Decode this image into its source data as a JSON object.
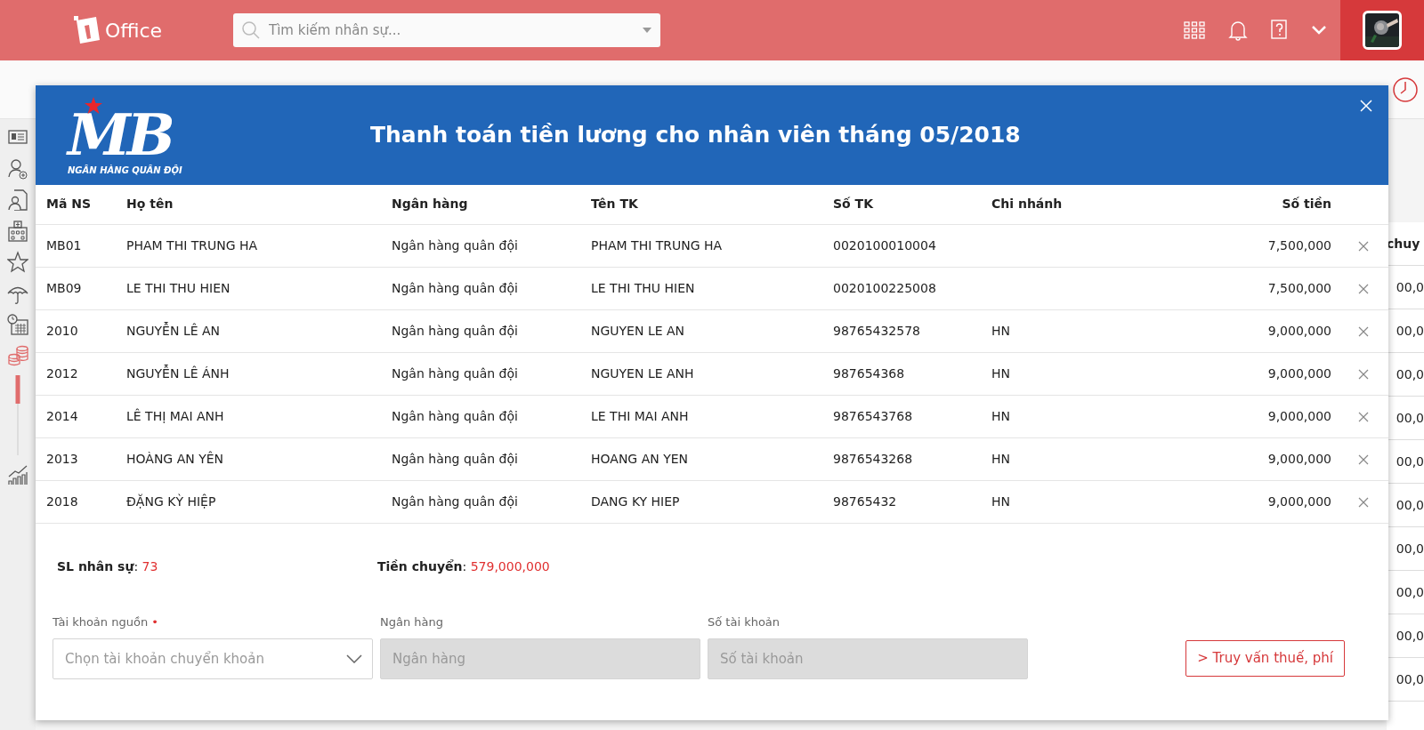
{
  "topbar": {
    "logo_text": "Office",
    "search": {
      "placeholder": "Tìm kiếm nhân sự..."
    }
  },
  "sidebar": {
    "items": [
      {
        "kind": "id-card",
        "selected": false
      },
      {
        "kind": "user-add",
        "selected": false
      },
      {
        "kind": "user-doc",
        "selected": false
      },
      {
        "kind": "building",
        "selected": false
      },
      {
        "kind": "star",
        "selected": false
      },
      {
        "kind": "umbrella",
        "selected": false
      },
      {
        "kind": "calendar",
        "selected": false
      },
      {
        "kind": "coins",
        "selected": true
      },
      {
        "kind": "chart",
        "selected": false
      }
    ]
  },
  "background_table": {
    "column_header": "chuy",
    "cells": [
      "00,0",
      "00,0",
      "00,0",
      "00,0",
      "00,0",
      "00,0",
      "00,0",
      "00,0",
      "00,0",
      "00,0"
    ]
  },
  "modal": {
    "bank_logo": {
      "letters": "MB",
      "tagline": "NGÂN HÀNG QUÂN ĐỘI"
    },
    "title": "Thanh toán tiền lương cho nhân viên tháng 05/2018",
    "table": {
      "columns": [
        "Mã NS",
        "Họ tên",
        "Ngân hàng",
        "Tên TK",
        "Số TK",
        "Chi nhánh",
        "Số tiền"
      ],
      "rows": [
        {
          "cells": [
            "MB01",
            "PHAM THI TRUNG HA",
            "Ngân hàng quân đội",
            "PHAM THI TRUNG HA",
            "0020100010004",
            "",
            "7,500,000"
          ]
        },
        {
          "cells": [
            "MB09",
            "LE THI THU HIEN",
            "Ngân hàng quân đội",
            "LE THI THU HIEN",
            "0020100225008",
            "",
            "7,500,000"
          ]
        },
        {
          "cells": [
            "2010",
            "NGUYỄN LÊ AN",
            "Ngân hàng quân đội",
            "NGUYEN LE AN",
            "98765432578",
            "HN",
            "9,000,000"
          ]
        },
        {
          "cells": [
            "2012",
            "NGUYỄN LÊ ÁNH",
            "Ngân hàng quân đội",
            "NGUYEN LE ANH",
            "987654368",
            "HN",
            "9,000,000"
          ]
        },
        {
          "cells": [
            "2014",
            "LÊ THỊ MAI ANH",
            "Ngân hàng quân đội",
            "LE THI MAI ANH",
            "9876543768",
            "HN",
            "9,000,000"
          ]
        },
        {
          "cells": [
            "2013",
            "HOÀNG AN YÊN",
            "Ngân hàng quân đội",
            "HOANG AN YEN",
            "9876543268",
            "HN",
            "9,000,000"
          ]
        },
        {
          "cells": [
            "2018",
            "ĐẶNG KỲ HIỆP",
            "Ngân hàng quân đội",
            "DANG KY HIEP",
            "98765432",
            "HN",
            "9,000,000"
          ]
        }
      ]
    },
    "summary": [
      {
        "label": "SL nhân sự",
        "separator": ":",
        "value": "73"
      },
      {
        "label": "Tiền chuyển",
        "separator": ":",
        "value": "579,000,000"
      }
    ],
    "fields": [
      {
        "kind": "select",
        "label": "Tài khoản nguồn",
        "required_mark": "•",
        "placeholder": "Chọn tài khoản chuyển khoản",
        "disabled": false
      },
      {
        "kind": "input",
        "label": "Ngân hàng",
        "placeholder": "Ngân hàng",
        "disabled": true
      },
      {
        "kind": "input",
        "label": "Số tài khoản",
        "placeholder": "Số tài khoản",
        "disabled": true
      }
    ],
    "action_button": "> Truy vấn thuế, phí"
  }
}
